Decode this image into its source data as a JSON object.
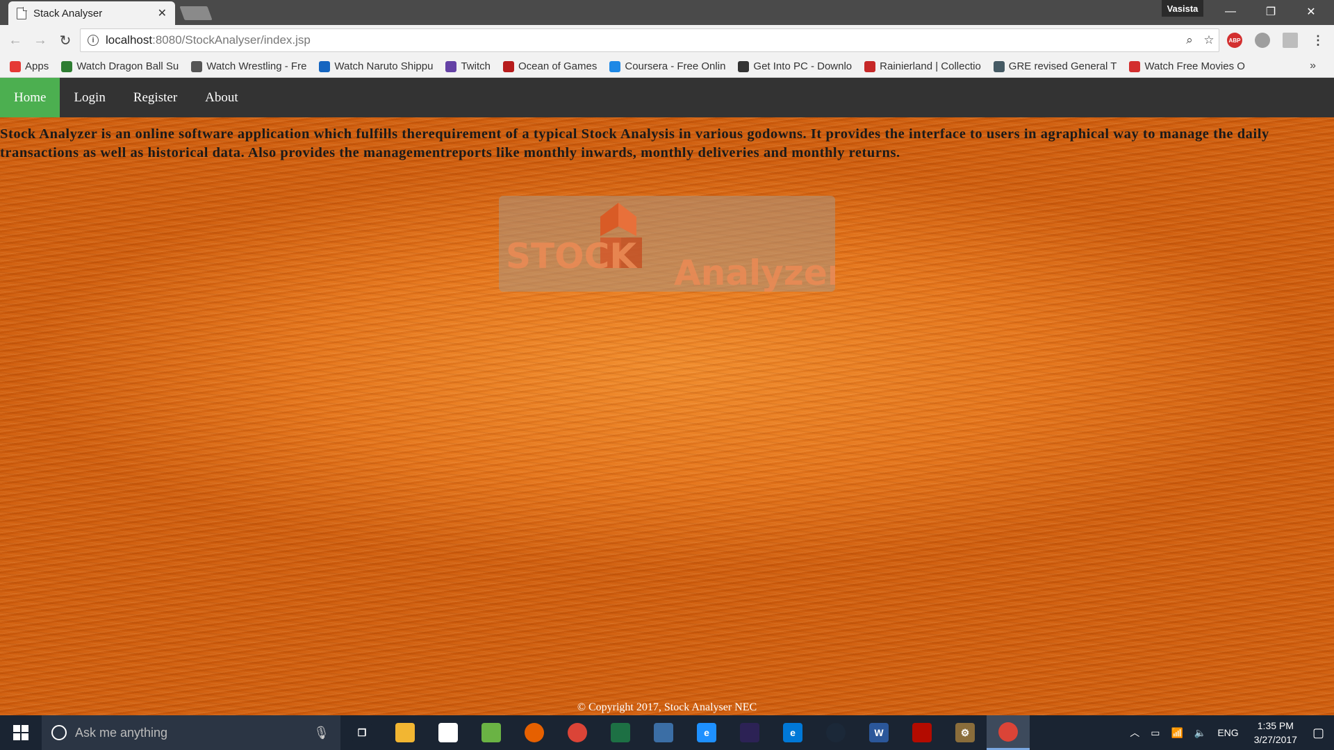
{
  "browser": {
    "tab_title": "Stack Analyser",
    "profile_name": "Vasista",
    "url_host": "localhost",
    "url_rest": ":8080/StockAnalyser/index.jsp",
    "window_controls": {
      "minimize": "—",
      "restore": "❐",
      "close": "✕"
    }
  },
  "bookmarks": [
    {
      "label": "Apps",
      "icon": "apps-icon",
      "color": "#e53935"
    },
    {
      "label": "Watch Dragon Ball Su",
      "icon": "dragonball-icon",
      "color": "#2e7d32"
    },
    {
      "label": "Watch Wrestling - Fre",
      "icon": "wordpress-icon",
      "color": "#555555"
    },
    {
      "label": "Watch Naruto Shippu",
      "icon": "naruto-icon",
      "color": "#1565c0"
    },
    {
      "label": "Twitch",
      "icon": "twitch-icon",
      "color": "#6441a5"
    },
    {
      "label": "Ocean of Games",
      "icon": "gamepad-icon",
      "color": "#b71c1c"
    },
    {
      "label": "Coursera - Free Onlin",
      "icon": "coursera-icon",
      "color": "#1e88e5"
    },
    {
      "label": "Get Into PC - Downlo",
      "icon": "getintopc-icon",
      "color": "#333333"
    },
    {
      "label": "Rainierland | Collectio",
      "icon": "rainierland-icon",
      "color": "#c62828"
    },
    {
      "label": "GRE revised General T",
      "icon": "ets-icon",
      "color": "#455a64"
    },
    {
      "label": "Watch Free Movies O",
      "icon": "movies-icon",
      "color": "#d32f2f"
    }
  ],
  "site": {
    "nav": [
      "Home",
      "Login",
      "Register",
      "About"
    ],
    "intro": "Stock Analyzer is an online software application which fulfills therequirement of a typical Stock Analysis in various godowns. It provides the interface to users in agraphical way to manage the daily transactions as well as historical data. Also provides the managementreports like monthly inwards, monthly deliveries and monthly returns.",
    "logo_word1": "STOCK",
    "logo_word2": "Analyzer",
    "footer": "© Copyright 2017, Stock Analyser NEC"
  },
  "taskbar": {
    "search_placeholder": "Ask me anything",
    "language": "ENG",
    "time": "1:35 PM",
    "date": "3/27/2017",
    "apps": [
      {
        "name": "task-view-icon",
        "color": "#1a2432",
        "glyph": "❐"
      },
      {
        "name": "file-explorer-icon",
        "color": "#f2b632",
        "glyph": ""
      },
      {
        "name": "store-icon",
        "color": "#ffffff",
        "glyph": ""
      },
      {
        "name": "android-studio-icon",
        "color": "#6ab344",
        "glyph": ""
      },
      {
        "name": "firefox-icon",
        "color": "#e66000",
        "glyph": ""
      },
      {
        "name": "chrome-icon",
        "color": "#db4437",
        "glyph": ""
      },
      {
        "name": "excel-icon",
        "color": "#1d7044",
        "glyph": ""
      },
      {
        "name": "netbeans-icon",
        "color": "#3b6ea5",
        "glyph": ""
      },
      {
        "name": "internet-explorer-icon",
        "color": "#1e90ff",
        "glyph": "e"
      },
      {
        "name": "eclipse-icon",
        "color": "#2c2255",
        "glyph": ""
      },
      {
        "name": "edge-icon",
        "color": "#0078d7",
        "glyph": "e"
      },
      {
        "name": "steam-icon",
        "color": "#1b2838",
        "glyph": ""
      },
      {
        "name": "word-icon",
        "color": "#2b579a",
        "glyph": "W"
      },
      {
        "name": "acrobat-icon",
        "color": "#b30b00",
        "glyph": ""
      },
      {
        "name": "settings-app-icon",
        "color": "#8a6d3b",
        "glyph": "⚙"
      },
      {
        "name": "chrome-active-icon",
        "color": "#db4437",
        "glyph": ""
      }
    ]
  }
}
